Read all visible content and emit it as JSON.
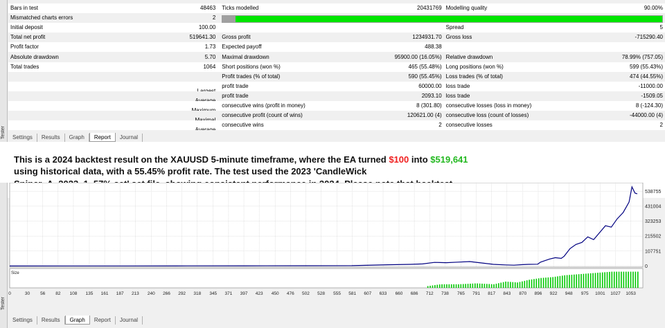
{
  "report": {
    "sidebar_label": "Tester",
    "rows": [
      [
        "Bars in test",
        "48463",
        "Ticks modelled",
        "20431769",
        "Modelling quality",
        "90.00%"
      ],
      [
        "Mismatched charts errors",
        "2",
        "",
        "",
        "",
        ""
      ],
      [
        "Initial deposit",
        "100.00",
        "",
        "",
        "Spread",
        "5"
      ],
      [
        "Total net profit",
        "519641.30",
        "Gross profit",
        "1234931.70",
        "Gross loss",
        "-715290.40"
      ],
      [
        "Profit factor",
        "1.73",
        "Expected payoff",
        "488.38",
        "",
        ""
      ],
      [
        "Absolute drawdown",
        "5.70",
        "Maximal drawdown",
        "95900.00 (16.05%)",
        "Relative drawdown",
        "78.99% (757.05)"
      ],
      [
        "Total trades",
        "1064",
        "Short positions (won %)",
        "465 (55.48%)",
        "Long positions (won %)",
        "599 (55.43%)"
      ],
      [
        "",
        "",
        "Profit trades (% of total)",
        "590 (55.45%)",
        "Loss trades (% of total)",
        "474 (44.55%)"
      ],
      [
        "",
        "Largest",
        "profit trade",
        "60000.00",
        "loss trade",
        "-11000.00"
      ],
      [
        "",
        "Average",
        "profit trade",
        "2093.10",
        "loss trade",
        "-1509.05"
      ],
      [
        "",
        "Maximum",
        "consecutive wins (profit in money)",
        "8 (301.80)",
        "consecutive losses (loss in money)",
        "8 (-124.30)"
      ],
      [
        "",
        "Maximal",
        "consecutive profit (count of wins)",
        "120621.00 (4)",
        "consecutive loss (count of losses)",
        "-44000.00 (4)"
      ],
      [
        "",
        "Average",
        "consecutive wins",
        "2",
        "consecutive losses",
        "2"
      ]
    ],
    "modelling_quality_fraction": 0.97,
    "tabs": [
      "Settings",
      "Results",
      "Graph",
      "Report",
      "Journal"
    ],
    "active_tab": "Report"
  },
  "caption": {
    "part1": "This is a 2024 backtest result on the XAUUSD 5-minute timeframe, where the EA turned ",
    "start_amount": "$100",
    "part2": " into ",
    "end_amount": "$519,641",
    "part3": " using historical data, with a 55.45% profit rate. The test used the 2023 'CandleWick Sniper_A_2023_1_57%.set' set file, showing consistent performance in 2024. Please note that backtest results are hypothetical and do not guarantee future performance.",
    "highlight_colors": {
      "start": "#f02020",
      "end": "#22b81f"
    }
  },
  "graph": {
    "sidebar_label": "Tester",
    "size_label": "Size",
    "tabs": [
      "Settings",
      "Results",
      "Graph",
      "Report",
      "Journal"
    ],
    "active_tab": "Graph",
    "colors": {
      "balance": "#000080",
      "volume": "#00c800",
      "grid": "#c8c8c8"
    }
  },
  "chart_data": {
    "type": "line",
    "title": "",
    "xlabel": "",
    "ylabel": "",
    "y_ticks": [
      "538755",
      "431004",
      "323253",
      "215502",
      "107751",
      "0"
    ],
    "y_tick_values": [
      538755,
      431004,
      323253,
      215502,
      107751,
      0
    ],
    "ylim": [
      -8000,
      600000
    ],
    "x_ticks": [
      "0",
      "30",
      "56",
      "82",
      "108",
      "135",
      "161",
      "187",
      "213",
      "240",
      "266",
      "292",
      "318",
      "345",
      "371",
      "397",
      "423",
      "450",
      "476",
      "502",
      "528",
      "555",
      "581",
      "607",
      "633",
      "660",
      "686",
      "712",
      "738",
      "765",
      "791",
      "817",
      "843",
      "870",
      "896",
      "922",
      "948",
      "975",
      "1001",
      "1027",
      "1053"
    ],
    "xlim": [
      0,
      1064
    ],
    "grid": true,
    "series": [
      {
        "x": [
          0,
          100,
          200,
          300,
          400,
          500,
          580,
          640,
          680,
          700,
          720,
          740,
          760,
          780,
          800,
          820,
          840,
          855,
          870,
          880,
          895,
          900,
          915,
          925,
          935,
          940,
          950,
          960,
          970,
          980,
          990,
          1000,
          1010,
          1020,
          1030,
          1040,
          1050,
          1055,
          1060,
          1064
        ],
        "values": [
          100,
          300,
          700,
          1100,
          1500,
          2000,
          2500,
          9000,
          12000,
          15000,
          26000,
          24000,
          28000,
          32000,
          22000,
          12000,
          8000,
          6000,
          10000,
          12000,
          13000,
          28000,
          50000,
          60000,
          55000,
          70000,
          125000,
          155000,
          170000,
          210000,
          190000,
          240000,
          290000,
          280000,
          340000,
          385000,
          460000,
          570000,
          525000,
          519641
        ]
      }
    ],
    "volume_bars": {
      "x": [
        708,
        730,
        760,
        790,
        820,
        840,
        860,
        880,
        900,
        920,
        940,
        960,
        980,
        1000,
        1020,
        1040,
        1060
      ],
      "values": [
        0.1,
        0.2,
        0.2,
        0.25,
        0.2,
        0.35,
        0.3,
        0.45,
        0.55,
        0.6,
        0.7,
        0.75,
        0.8,
        0.85,
        0.9,
        0.9,
        0.9
      ]
    }
  }
}
